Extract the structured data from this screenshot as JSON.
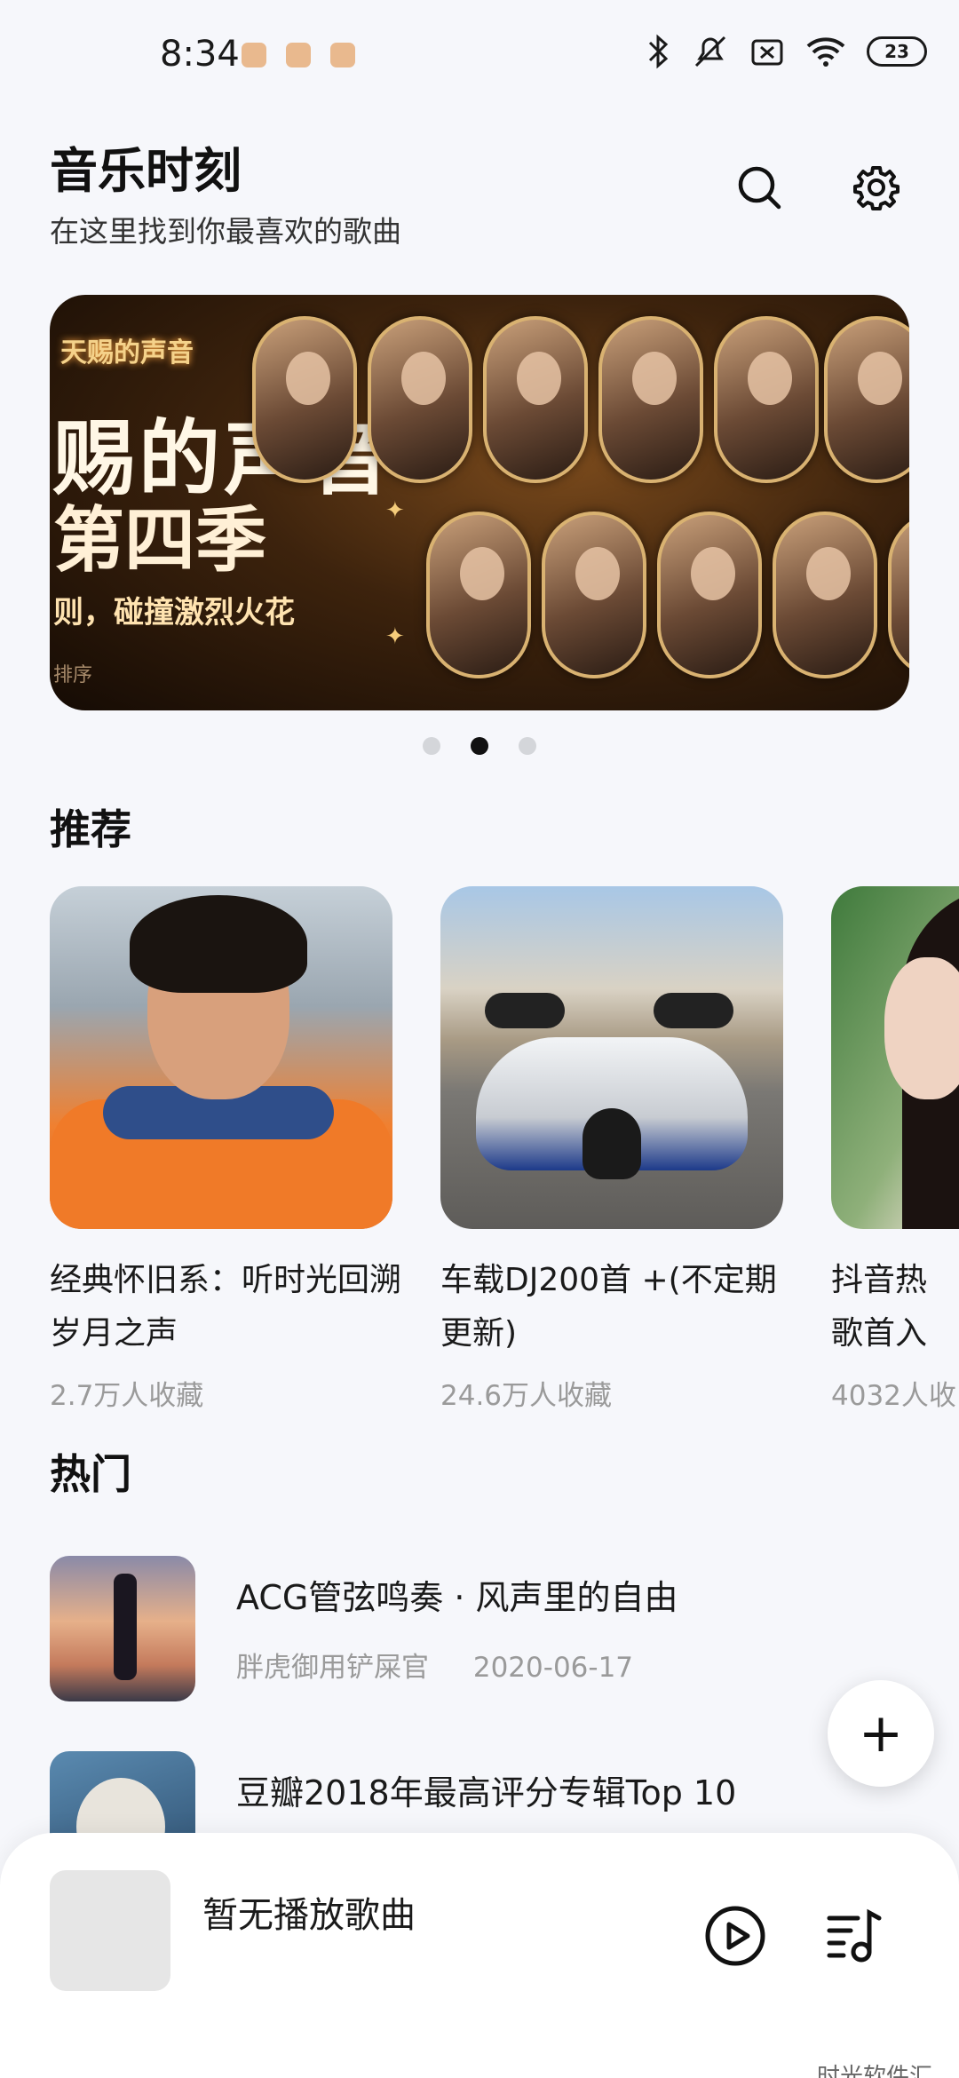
{
  "status_bar": {
    "time": "8:34",
    "battery": "23",
    "icons": [
      "bluetooth-icon",
      "mute-icon",
      "sim-off-icon",
      "wifi-icon",
      "battery-icon"
    ]
  },
  "header": {
    "title": "音乐时刻",
    "subtitle": "在这里找到你最喜欢的歌曲"
  },
  "banner": {
    "logo_text": "天赐的声音",
    "line1": "赐的声音",
    "line2": "第四季",
    "line3": "则，碰撞激烈火花",
    "line4": "排序",
    "page_count": 3,
    "active_page": 2
  },
  "recommend": {
    "title": "推荐",
    "cards": [
      {
        "title": "经典怀旧系：听时光回溯岁月之声",
        "favorites": "2.7万人收藏"
      },
      {
        "title": "车载DJ200首 +(不定期更新)",
        "favorites": "24.6万人收藏"
      },
      {
        "title": "抖音热歌首入心",
        "favorites": "4032人收"
      }
    ]
  },
  "hot": {
    "title": "热门",
    "items": [
      {
        "title": "ACG管弦鸣奏 · 风声里的自由",
        "author": "胖虎御用铲屎官",
        "date": "2020-06-17"
      },
      {
        "title": "豆瓣2018年最高评分专辑Top 10",
        "author": "",
        "date": ""
      }
    ]
  },
  "player": {
    "title": "暂无播放歌曲"
  },
  "fab": {
    "label": "+"
  },
  "watermark": "时光软件汇",
  "colors": {
    "accent": "#111111",
    "background": "#f6f7fb",
    "muted": "#9a9a9a"
  }
}
